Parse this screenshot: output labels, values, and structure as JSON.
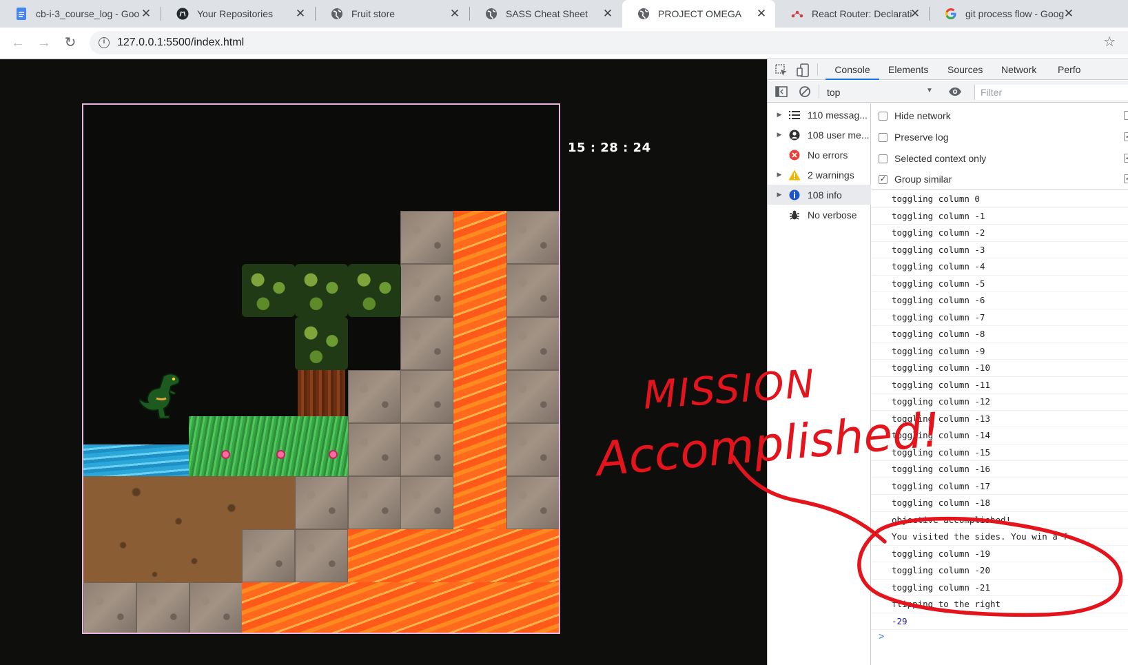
{
  "browser": {
    "tabs": [
      {
        "title": "cb-i-3_course_log - Goo",
        "icon": "google-docs-icon"
      },
      {
        "title": "Your Repositories",
        "icon": "github-icon"
      },
      {
        "title": "Fruit store",
        "icon": "globe-icon"
      },
      {
        "title": "SASS Cheat Sheet",
        "icon": "globe-icon"
      },
      {
        "title": "PROJECT OMEGA",
        "icon": "globe-icon"
      },
      {
        "title": "React Router: Declarati",
        "icon": "react-router-icon"
      },
      {
        "title": "git process flow - Goog",
        "icon": "google-icon"
      }
    ],
    "active_tab": 4,
    "url": "127.0.0.1:5500/index.html"
  },
  "game": {
    "timer": "15 : 28 : 24"
  },
  "devtools": {
    "tabs": [
      "Console",
      "Elements",
      "Sources",
      "Network",
      "Perfo"
    ],
    "active_tab": "Console",
    "context": "top",
    "filter_placeholder": "Filter",
    "sidebar": [
      {
        "label": "110 messag...",
        "icon": "list-icon",
        "expandable": true
      },
      {
        "label": "108 user me...",
        "icon": "user-icon",
        "expandable": true
      },
      {
        "label": "No errors",
        "icon": "error-icon",
        "expandable": false
      },
      {
        "label": "2 warnings",
        "icon": "warning-icon",
        "expandable": true
      },
      {
        "label": "108 info",
        "icon": "info-icon",
        "expandable": true,
        "selected": true
      },
      {
        "label": "No verbose",
        "icon": "bug-icon",
        "expandable": false
      }
    ],
    "settings": [
      {
        "label": "Hide network",
        "checked": false
      },
      {
        "label": "Preserve log",
        "checked": false
      },
      {
        "label": "Selected context only",
        "checked": false
      },
      {
        "label": "Group similar",
        "checked": true
      }
    ],
    "log": [
      "toggling column 0",
      "toggling column -1",
      "toggling column -2",
      "toggling column -3",
      "toggling column -4",
      "toggling column -5",
      "toggling column -6",
      "toggling column -7",
      "toggling column -8",
      "toggling column -9",
      "toggling column -10",
      "toggling column -11",
      "toggling column -12",
      "toggling column -13",
      "toggling column -14",
      "toggling column -15",
      "toggling column -16",
      "toggling column -17",
      "toggling column -18",
      "objective accomplished!",
      "You visited the sides. You win a f",
      "toggling column -19",
      "toggling column -20",
      "toggling column -21",
      "flipping to the right",
      "-29"
    ],
    "prompt": ">"
  },
  "annotation": {
    "line1": "MISSION",
    "line2": "Accomplished!",
    "color": "#e3141b"
  }
}
